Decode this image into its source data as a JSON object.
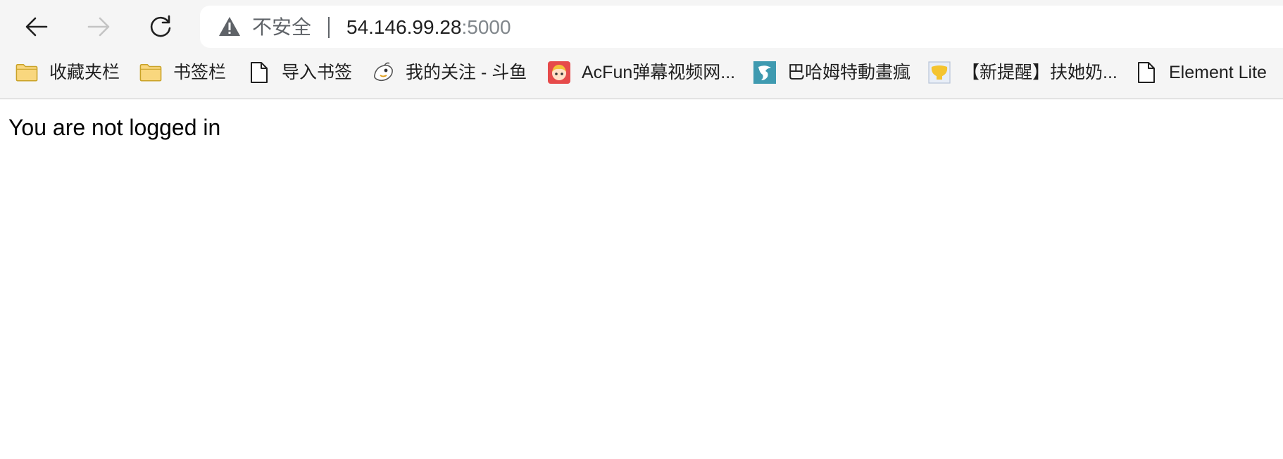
{
  "toolbar": {
    "back_icon": "arrow-left-icon",
    "forward_icon": "arrow-right-icon",
    "reload_icon": "reload-icon",
    "forward_disabled": true
  },
  "omnibox": {
    "security_icon": "warning-triangle-icon",
    "security_label": "不安全",
    "url_host": "54.146.99.28",
    "url_port": ":5000"
  },
  "bookmarks": [
    {
      "label": "收藏夹栏",
      "icon": "folder-icon"
    },
    {
      "label": "书签栏",
      "icon": "folder-icon"
    },
    {
      "label": "导入书签",
      "icon": "page-icon"
    },
    {
      "label": "我的关注 - 斗鱼",
      "icon": "douyu-favicon-icon"
    },
    {
      "label": "AcFun弹幕视频网...",
      "icon": "acfun-favicon-icon"
    },
    {
      "label": "巴哈姆特動畫瘋",
      "icon": "bahamut-favicon-icon"
    },
    {
      "label": "【新提醒】扶她奶...",
      "icon": "forum-favicon-icon"
    },
    {
      "label": "Element Lite",
      "icon": "page-icon"
    }
  ],
  "page": {
    "message": "You are not logged in"
  },
  "colors": {
    "chrome_bg": "#f5f5f5",
    "folder_fill": "#f9d77e",
    "folder_stroke": "#c9a227",
    "acfun_red": "#e64a4a",
    "bahamut_teal": "#3f9ab0"
  }
}
